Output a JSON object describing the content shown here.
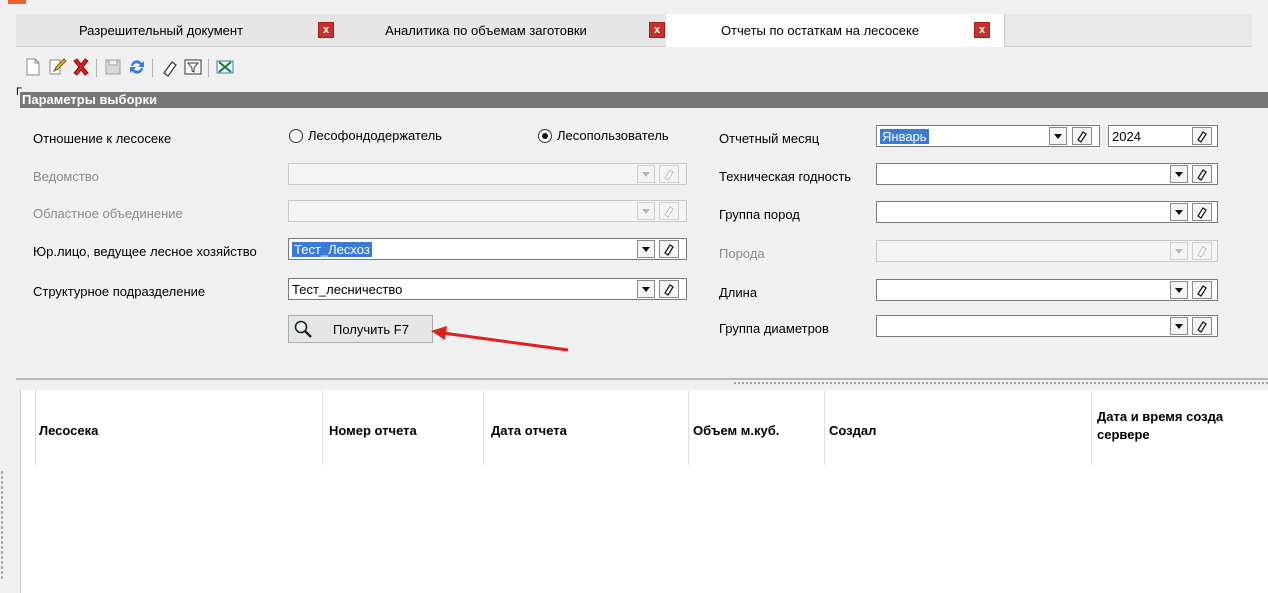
{
  "tabs": [
    {
      "label": "Разрешительный документ",
      "close": "x"
    },
    {
      "label": "Аналитика по объемам заготовки",
      "close": "x"
    },
    {
      "label": "Отчеты по остаткам на лесосеке",
      "close": "x"
    }
  ],
  "toolbar": {
    "icons": [
      "new-document-icon",
      "edit-icon",
      "delete-icon",
      "save-icon",
      "refresh-icon",
      "eraser-icon",
      "filter-icon",
      "excel-export-icon"
    ]
  },
  "params": {
    "tick": "Г",
    "title": "Параметры выборки",
    "relation_label": "Отношение к лесосеке",
    "radio_holder": "Лесофондодержатель",
    "radio_user": "Лесопользователь",
    "radio_selected": "user",
    "department_label": "Ведомство",
    "department_value": "",
    "regional_label": "Областное объединение",
    "regional_value": "",
    "legal_label": "Юр.лицо, ведущее лесное хозяйство",
    "legal_value": "Тест_Лесхоз",
    "structural_label": "Структурное подразделение",
    "structural_value": "Тест_лесничество",
    "get_button": "Получить F7",
    "month_label": "Отчетный месяц",
    "month_value": "Январь",
    "year_value": "2024",
    "suitability_label": "Техническая годность",
    "suitability_value": "",
    "species_group_label": "Группа пород",
    "species_group_value": "",
    "species_label": "Порода",
    "species_value": "",
    "length_label": "Длина",
    "length_value": "",
    "diameter_label": "Группа диаметров",
    "diameter_value": ""
  },
  "grid": {
    "columns": [
      "Лесосека",
      "Номер отчета",
      "Дата отчета",
      "Объем м.куб.",
      "Создал",
      "Дата и время созда",
      "сервере"
    ]
  },
  "colors": {
    "accent_arrow": "#e02020",
    "selection": "#3a7bd5",
    "close_button": "#c9302c",
    "header_bar": "#777777"
  }
}
